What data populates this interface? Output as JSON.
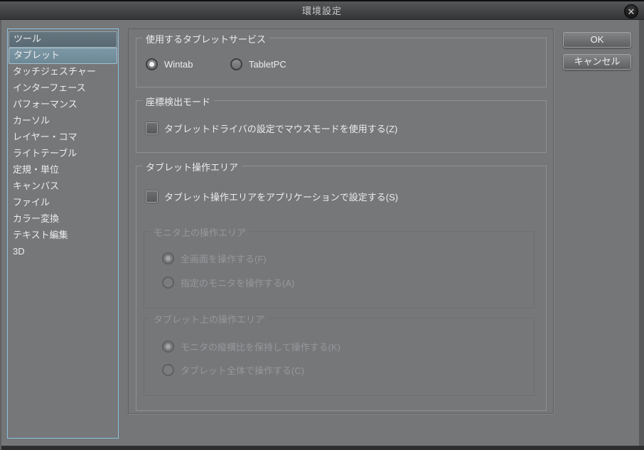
{
  "window": {
    "title": "環境設定",
    "close_glyph": "✕"
  },
  "actions": {
    "ok": "OK",
    "cancel": "キャンセル"
  },
  "sidebar": {
    "items": [
      {
        "label": "ツール",
        "state": "focus"
      },
      {
        "label": "タブレット",
        "state": "selected"
      },
      {
        "label": "タッチジェスチャー",
        "state": ""
      },
      {
        "label": "インターフェース",
        "state": ""
      },
      {
        "label": "パフォーマンス",
        "state": ""
      },
      {
        "label": "カーソル",
        "state": ""
      },
      {
        "label": "レイヤー・コマ",
        "state": ""
      },
      {
        "label": "ライトテーブル",
        "state": ""
      },
      {
        "label": "定規・単位",
        "state": ""
      },
      {
        "label": "キャンバス",
        "state": ""
      },
      {
        "label": "ファイル",
        "state": ""
      },
      {
        "label": "カラー変換",
        "state": ""
      },
      {
        "label": "テキスト編集",
        "state": ""
      },
      {
        "label": "3D",
        "state": ""
      }
    ]
  },
  "groups": {
    "tablet_service": {
      "legend": "使用するタブレットサービス",
      "radio_wintab": {
        "label": "Wintab",
        "selected": true
      },
      "radio_tabletpc": {
        "label": "TabletPC",
        "selected": false
      }
    },
    "coord_mode": {
      "legend": "座標検出モード",
      "checkbox": {
        "label": "タブレットドライバの設定でマウスモードを使用する(Z)",
        "checked": false
      }
    },
    "tablet_area": {
      "legend": "タブレット操作エリア",
      "checkbox": {
        "label": "タブレット操作エリアをアプリケーションで設定する(S)",
        "checked": false
      },
      "monitor_area": {
        "legend": "モニタ上の操作エリア",
        "disabled": true,
        "radio_fullscreen": {
          "label": "全画面を操作する(F)",
          "selected": true
        },
        "radio_monitor": {
          "label": "指定のモニタを操作する(A)",
          "selected": false
        }
      },
      "tablet_surface": {
        "legend": "タブレット上の操作エリア",
        "disabled": true,
        "radio_aspect": {
          "label": "モニタの縦横比を保持して操作する(K)",
          "selected": true
        },
        "radio_whole": {
          "label": "タブレット全体で操作する(C)",
          "selected": false
        }
      }
    }
  },
  "colors": {
    "dialog_bg": "#747678",
    "selection_bg": "#7c97a5",
    "list_focus_border": "#8cc0e0",
    "titlebar_top": "#565758",
    "titlebar_bottom": "#343536"
  }
}
